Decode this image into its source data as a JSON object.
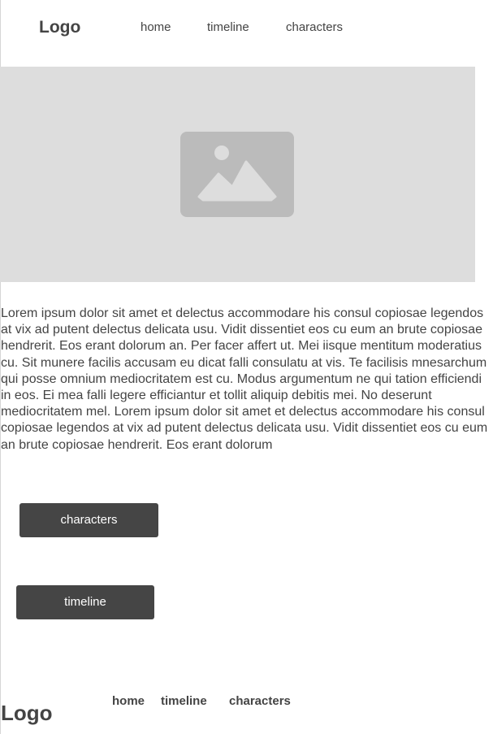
{
  "header": {
    "logo": "Logo",
    "nav": {
      "home": "home",
      "timeline": "timeline",
      "characters": "characters"
    }
  },
  "hero": {
    "icon": "image-placeholder-icon"
  },
  "main": {
    "paragraph": "Lorem ipsum dolor sit amet et delectus accommodare his consul copiosae legendos at vix ad putent delectus delicata usu. Vidit dissentiet eos cu eum an brute copiosae hendrerit. Eos erant dolorum an. Per facer affert ut. Mei iisque mentitum moderatius cu. Sit munere facilis accusam eu dicat falli consulatu at vis. Te facilisis mnesarchum qui posse omnium mediocritatem est cu. Modus argumentum ne qui tation efficiendi in eos. Ei mea falli legere efficiantur et tollit aliquip debitis mei. No deserunt mediocritatem mel. Lorem ipsum dolor sit amet et delectus accommodare his consul copiosae legendos at vix ad putent delectus delicata usu. Vidit dissentiet eos cu eum an brute copiosae hendrerit. Eos erant dolorum",
    "buttons": {
      "characters": "characters",
      "timeline": "timeline"
    }
  },
  "footer": {
    "logo": "Logo",
    "nav": {
      "home": "home",
      "timeline": "timeline",
      "characters": "characters"
    }
  },
  "colors": {
    "text": "#444444",
    "button_bg": "#454545",
    "placeholder_bg": "#dddddd",
    "placeholder_icon": "#bbbbbb"
  }
}
